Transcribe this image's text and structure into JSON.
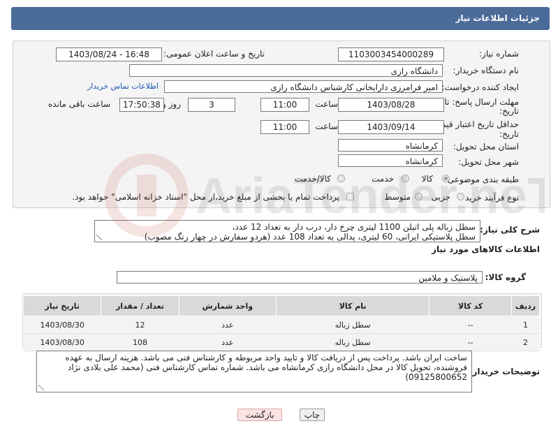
{
  "header": {
    "title": "جزئیات اطلاعات نیاز"
  },
  "form": {
    "need_number_label": "شماره نیاز:",
    "need_number": "1103003454000289",
    "announce_label": "تاریخ و ساعت اعلان عمومی:",
    "announce_value": "1403/08/24 - 16:48",
    "buyer_org_label": "نام دستگاه خریدار:",
    "buyer_org": "دانشگاه رازی",
    "requester_label": "ایجاد کننده درخواست:",
    "requester": "امیر فرامرزی دارایخانی کارشناس دانشگاه رازی",
    "contact_link": "اطلاعات تماس خریدار",
    "reply_deadline_label_1": "مهلت ارسال پاسخ: تا",
    "reply_deadline_label_2": "تاریخ:",
    "reply_date": "1403/08/28",
    "time_label": "ساعت",
    "reply_time": "11:00",
    "days_value": "3",
    "days_label": "روز و",
    "remaining_time": "17:50:38",
    "remaining_label": "ساعت باقی مانده",
    "price_validity_label_1": "حداقل تاریخ اعتبار قیمت: تا",
    "price_validity_label_2": "تاریخ:",
    "price_date": "1403/09/14",
    "price_time": "11:00",
    "province_label": "استان محل تحویل:",
    "province": "کرمانشاه",
    "city_label": "شهر محل تحویل:",
    "city": "کرمانشاه",
    "category_label": "طبقه بندی موضوعی:",
    "category_options": [
      "کالا",
      "خدمت",
      "کالا/خدمت"
    ],
    "category_selected": "کالا",
    "purchase_type_label": "نوع فرآیند خرید :",
    "purchase_options": [
      "جزیی",
      "متوسط"
    ],
    "payment_note": "پرداخت تمام یا بخشی از مبلغ خرید،از محل \"اسناد خزانه اسلامی\" خواهد بود."
  },
  "summary": {
    "label": "شرح کلی نیاز:",
    "line1": "سطل زباله پلی اتیلن 1100 لیتری چرخ دار، درب دار به تعداد 12 عدد،",
    "line2": "سطل پلاستیکی ایرانی، 60 لیتری، پدالی به تعداد 108 عدد (هردو سفارش در چهار رنگ مصوب)"
  },
  "goods": {
    "section_title": "اطلاعات کالاهای مورد نیاز",
    "group_label": "گروه کالا:",
    "group_value": "پلاستیک و ملامین",
    "columns": [
      "ردیف",
      "کد کالا",
      "نام کالا",
      "واحد شمارش",
      "تعداد / مقدار",
      "تاریخ نیاز"
    ],
    "rows": [
      {
        "row": "1",
        "code": "--",
        "name": "سطل زباله",
        "unit": "عدد",
        "qty": "12",
        "date": "1403/08/30"
      },
      {
        "row": "2",
        "code": "--",
        "name": "سطل زباله",
        "unit": "عدد",
        "qty": "108",
        "date": "1403/08/30"
      }
    ]
  },
  "buyer_notes": {
    "label": "توضیحات خریدار:",
    "line1": "ساخت ایران باشد. پرداخت پس از دریافت کالا و تایید واحد مربوطه و کارشناس فنی می باشد. هزینه ارسال به عهده",
    "line2": "فروشنده، تحویل کالا در محل دانشگاه رازی کرمانشاه می باشد. شماره تماس کارشناس فنی (محمد علی بلادی نژاد",
    "line3": "09125800652)"
  },
  "buttons": {
    "print": "چاپ",
    "back": "بازگشت"
  },
  "watermark": {
    "text": "AriaTender.neT"
  }
}
